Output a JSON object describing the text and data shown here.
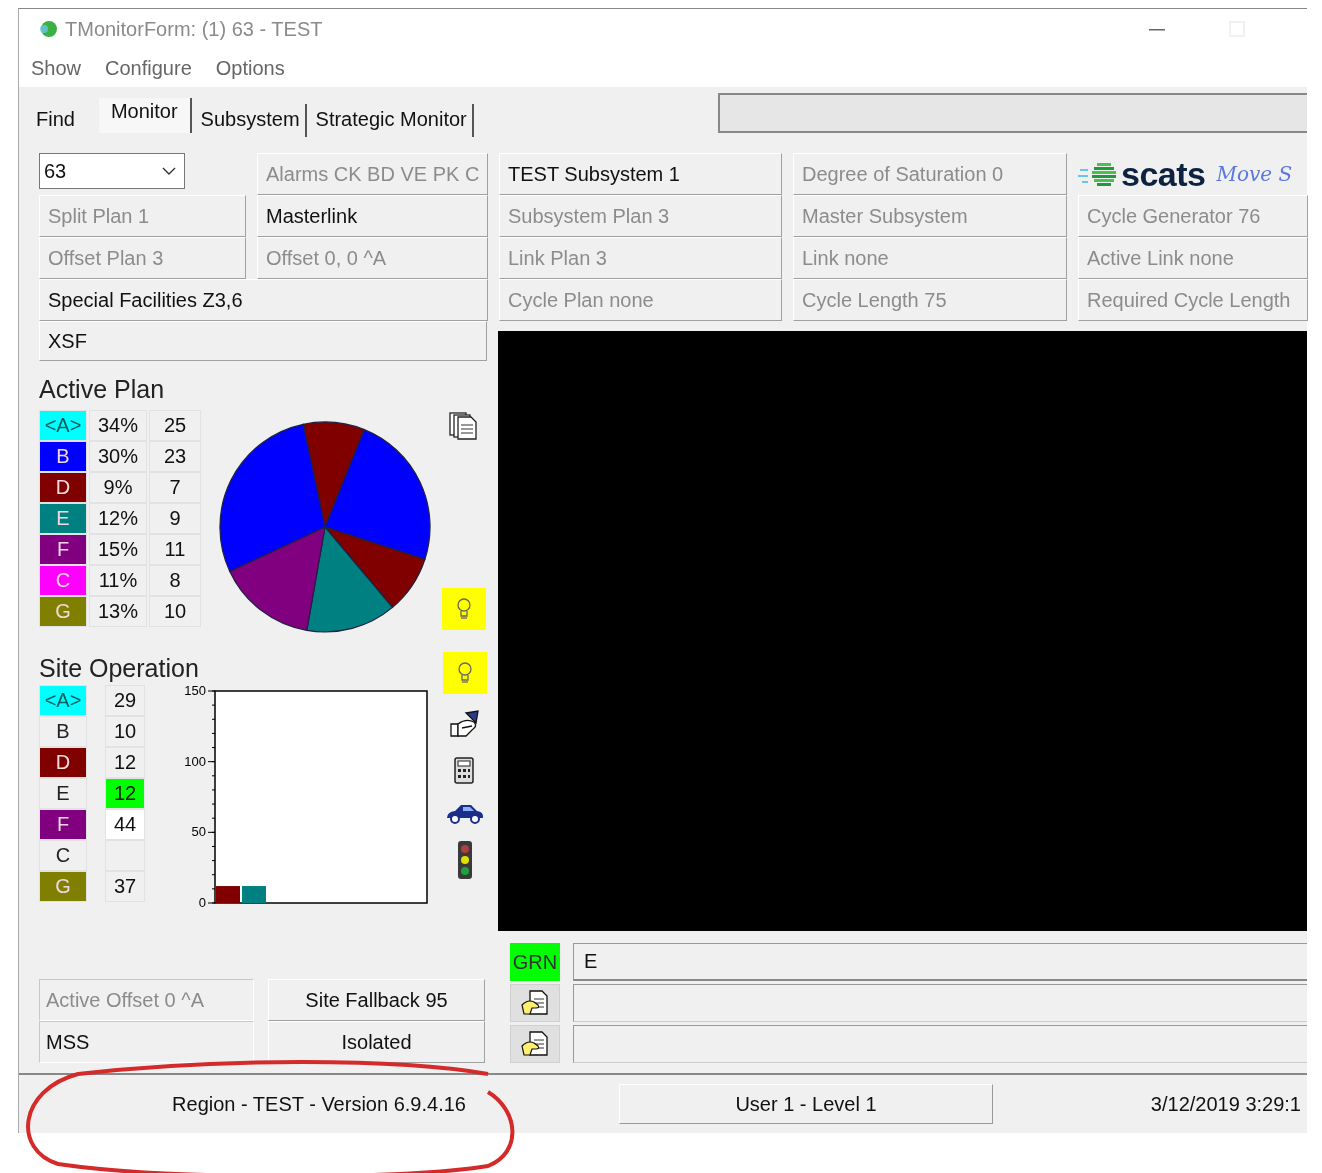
{
  "window": {
    "title": "TMonitorForm: (1)  63 - TEST"
  },
  "menu": [
    "Show",
    "Configure",
    "Options"
  ],
  "tabs": [
    {
      "label": "Find",
      "selected": false
    },
    {
      "label": "Monitor",
      "selected": true
    },
    {
      "label": "Subsystem",
      "selected": false
    },
    {
      "label": "Strategic Monitor",
      "selected": false
    }
  ],
  "info_grid": [
    {
      "kind": "combo",
      "value": "63"
    },
    {
      "kind": "label",
      "text": "Alarms CK BD VE PK C",
      "disabled": true
    },
    {
      "kind": "label",
      "text": "TEST Subsystem 1",
      "disabled": false
    },
    {
      "kind": "label",
      "text": "Degree of Saturation 0",
      "disabled": true
    },
    {
      "kind": "logo",
      "name": "scats",
      "tagline": "Move S"
    },
    {
      "kind": "label",
      "text": "Split Plan 1",
      "disabled": true
    },
    {
      "kind": "label",
      "text": "Masterlink",
      "disabled": false
    },
    {
      "kind": "label",
      "text": "Subsystem Plan 3",
      "disabled": true
    },
    {
      "kind": "label",
      "text": "Master Subsystem",
      "disabled": true
    },
    {
      "kind": "label",
      "text": "Cycle Generator 76",
      "disabled": true
    },
    {
      "kind": "label",
      "text": "Offset Plan 3",
      "disabled": true
    },
    {
      "kind": "label",
      "text": "Offset 0, 0 ^A",
      "disabled": true
    },
    {
      "kind": "label",
      "text": "Link Plan 3",
      "disabled": true
    },
    {
      "kind": "label",
      "text": "Link none",
      "disabled": true
    },
    {
      "kind": "label",
      "text": "Active Link none",
      "disabled": true
    },
    {
      "kind": "wide",
      "text": "Special Facilities  Z3,6",
      "disabled": false
    },
    {
      "kind": "label",
      "text": "Cycle Plan none",
      "disabled": true
    },
    {
      "kind": "label",
      "text": "Cycle Length 75",
      "disabled": true
    },
    {
      "kind": "label",
      "text": "Required Cycle Length",
      "disabled": true
    }
  ],
  "xsf": {
    "text": "XSF",
    "disabled": false
  },
  "active_plan": {
    "title": "Active Plan",
    "rows": [
      {
        "stage": "<A>",
        "color": "#00ffff",
        "percent": "34%",
        "time": "25"
      },
      {
        "stage": "B",
        "color": "#0000ff",
        "percent": "30%",
        "time": "23"
      },
      {
        "stage": "D",
        "color": "#800000",
        "percent": "9%",
        "time": "7"
      },
      {
        "stage": "E",
        "color": "#008080",
        "percent": "12%",
        "time": "9"
      },
      {
        "stage": "F",
        "color": "#800080",
        "percent": "15%",
        "time": "11"
      },
      {
        "stage": "C",
        "color": "#ff00ff",
        "percent": "11%",
        "time": "8"
      },
      {
        "stage": "G",
        "color": "#808000",
        "percent": "13%",
        "time": "10"
      }
    ]
  },
  "site_operation": {
    "title": "Site Operation",
    "rows": [
      {
        "stage": "<A>",
        "color": "#00ffff",
        "value": {
          "text": "29"
        }
      },
      {
        "stage": "B",
        "value": {
          "text": "10"
        }
      },
      {
        "stage": "D",
        "color": "#800000",
        "value": {
          "text": "12"
        }
      },
      {
        "stage": "E",
        "value": {
          "text": "12",
          "color": "#00ff00"
        }
      },
      {
        "stage": "F",
        "color": "#800080",
        "value": {
          "text": "44",
          "color": "#ffffff"
        }
      },
      {
        "stage": "C"
      },
      {
        "stage": "G",
        "color": "#808000",
        "value": {
          "text": "37"
        }
      }
    ],
    "chart_data": {
      "type": "bar",
      "series": [
        {
          "color": "#800000",
          "values": [
            12
          ]
        },
        {
          "color": "#008080",
          "values": [
            12
          ]
        }
      ],
      "ylim": [
        0,
        150
      ],
      "yticks": [
        0,
        50,
        100,
        150
      ]
    }
  },
  "offsets": [
    {
      "kind": "field",
      "text": "Active Offset 0 ^A",
      "disabled": true
    },
    {
      "kind": "button",
      "text": "Site Fallback 95",
      "disabled": false
    },
    {
      "kind": "field",
      "text": "MSS",
      "disabled": false
    },
    {
      "kind": "button",
      "text": "Isolated",
      "disabled": false
    }
  ],
  "phase_rows": [
    {
      "kind": "status",
      "label": "GRN",
      "color": "#00ff00",
      "value": "E"
    },
    {
      "kind": "action"
    },
    {
      "kind": "action"
    }
  ],
  "status_bar": [
    {
      "kind": "plain",
      "text": "Region - TEST - Version 6.9.4.16"
    },
    {
      "kind": "box",
      "text": "User 1 - Level 1"
    },
    {
      "kind": "right",
      "text": "3/12/2019  3:29:1"
    }
  ]
}
